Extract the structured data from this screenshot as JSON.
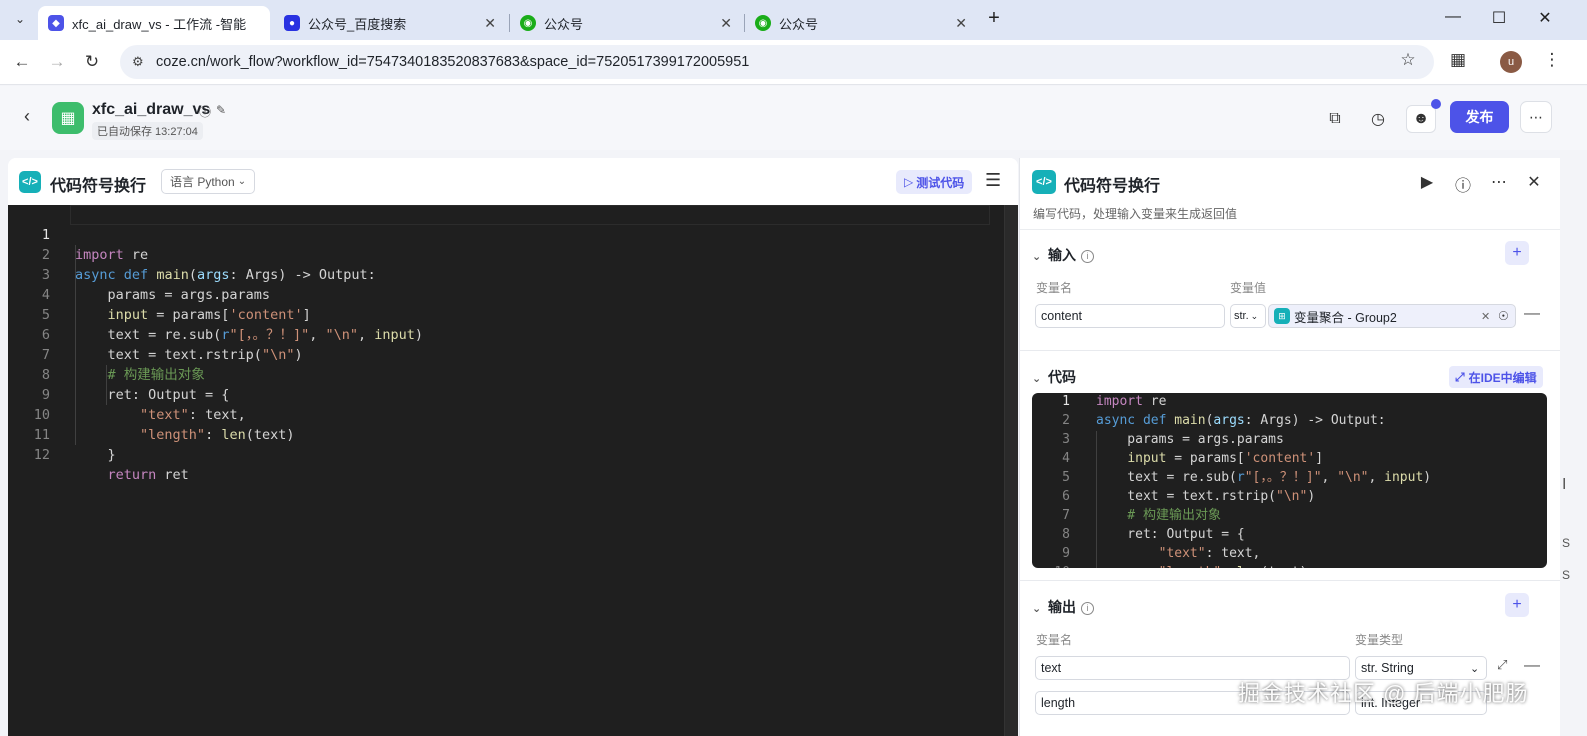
{
  "browser": {
    "tabs": [
      {
        "title": "xfc_ai_draw_vs - 工作流 -智能",
        "icon": "coze-icon",
        "color": "#4d53e8"
      },
      {
        "title": "公众号_百度搜索",
        "icon": "baidu-paw-icon",
        "color": "#2932e1"
      },
      {
        "title": "公众号",
        "icon": "wechat-icon",
        "color": "#1aad19"
      },
      {
        "title": "公众号",
        "icon": "wechat-icon",
        "color": "#1aad19"
      }
    ],
    "url": "coze.cn/work_flow?workflow_id=7547340183520837683&space_id=7520517399172005951",
    "avatar_letter": "u"
  },
  "app": {
    "name": "xfc_ai_draw_vs",
    "autosave": "已自动保存 13:27:04",
    "publish_label": "发布",
    "brand_color": "#4d53e8"
  },
  "left_panel": {
    "title": "代码符号换行",
    "language": "语言 Python",
    "test_label": "测试代码"
  },
  "right_panel": {
    "title": "代码符号换行",
    "description": "编写代码，处理输入变量来生成返回值",
    "input_section": {
      "title": "输入",
      "col_name": "变量名",
      "col_value": "变量值",
      "rows": [
        {
          "name": "content",
          "type_short": "str.",
          "value_ref": "变量聚合 - Group2"
        }
      ]
    },
    "code_section": {
      "title": "代码",
      "ide_label": "在IDE中编辑"
    },
    "output_section": {
      "title": "输出",
      "col_name": "变量名",
      "col_type": "变量类型",
      "rows": [
        {
          "name": "text",
          "type": "str. String"
        },
        {
          "name": "length",
          "type": "int. Integer"
        }
      ]
    }
  },
  "code": {
    "line_numbers": [
      "1",
      "2",
      "3",
      "4",
      "5",
      "6",
      "7",
      "8",
      "9",
      "10",
      "11",
      "12"
    ],
    "lines": [
      "import re",
      "async def main(args: Args) -> Output:",
      "    params = args.params",
      "    input = params['content']",
      "    text = re.sub(r\"[，。？！]\", \"\\n\", input)",
      "    text = text.rstrip(\"\\n\")",
      "    # 构建输出对象",
      "    ret: Output = {",
      "        \"text\": text,",
      "        \"length\": len(text)",
      "    }",
      "    return ret"
    ]
  },
  "watermark": "掘金技术社区 @ 后端小肥肠",
  "edge_chars": [
    "I",
    "S",
    "S"
  ]
}
